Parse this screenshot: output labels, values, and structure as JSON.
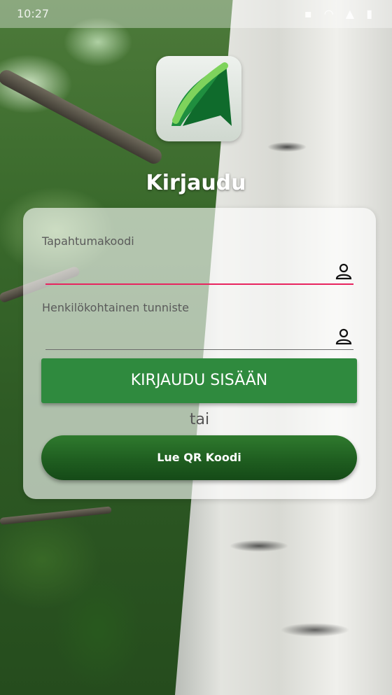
{
  "status_bar": {
    "time": "10:27",
    "icons": [
      "notification-icon",
      "wifi-icon",
      "signal-icon",
      "battery-icon"
    ]
  },
  "header": {
    "logo_icon": "leaf-arrow-logo",
    "title": "Kirjaudu"
  },
  "form": {
    "event_code": {
      "label": "Tapahtumakoodi",
      "value": "",
      "icon": "user-icon",
      "underline_color": "#e8245f"
    },
    "personal_id": {
      "label": "Henkilökohtainen tunniste",
      "value": "",
      "icon": "user-icon"
    },
    "login_button_label": "KIRJAUDU SISÄÄN",
    "or_text": "tai",
    "qr_button_label": "Lue QR Koodi"
  },
  "colors": {
    "primary_green": "#2f8a3e",
    "dark_green": "#154a17",
    "accent_pink": "#e8245f"
  }
}
